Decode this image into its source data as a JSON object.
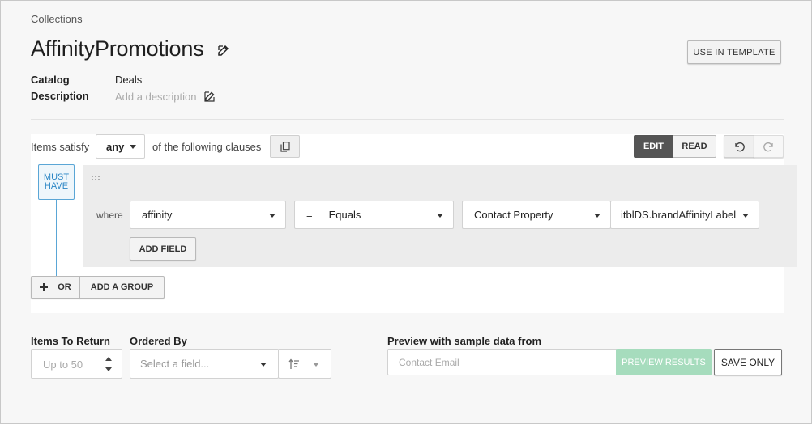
{
  "breadcrumb": "Collections",
  "title": "AffinityPromotions",
  "actions": {
    "use_in_template": "USE IN TEMPLATE"
  },
  "meta": {
    "catalog_label": "Catalog",
    "catalog_value": "Deals",
    "description_label": "Description",
    "description_placeholder": "Add a description"
  },
  "clauses": {
    "items_satisfy": "Items satisfy",
    "match_mode": "any",
    "following": "of the following clauses",
    "mode_edit": "EDIT",
    "mode_read": "READ"
  },
  "group": {
    "must_have_line1": "MUST",
    "must_have_line2": "HAVE",
    "where": "where",
    "field": "affinity",
    "operator_symbol": "=",
    "operator": "Equals",
    "source": "Contact Property",
    "property": "itblDS.brandAffinityLabel",
    "add_field": "ADD FIELD",
    "or": "OR",
    "add_group": "ADD A GROUP"
  },
  "bottom": {
    "items_to_return_label": "Items To Return",
    "items_to_return_placeholder": "Up to 50",
    "ordered_by_label": "Ordered By",
    "ordered_by_placeholder": "Select a field...",
    "preview_label": "Preview with sample data from",
    "contact_email_placeholder": "Contact Email",
    "preview_results": "PREVIEW RESULTS",
    "save_only": "SAVE ONLY"
  },
  "icons": {
    "title_edit": "edit-icon",
    "description_edit": "edit-icon",
    "copy": "copy-icon",
    "undo": "undo-icon",
    "redo": "redo-icon",
    "drag": "drag-handle-icon",
    "plus": "plus-icon",
    "sort": "sort-icon"
  },
  "colors": {
    "accent_blue": "#2b86c5",
    "edit_active": "#555555",
    "preview_green": "#a6dcbd"
  }
}
